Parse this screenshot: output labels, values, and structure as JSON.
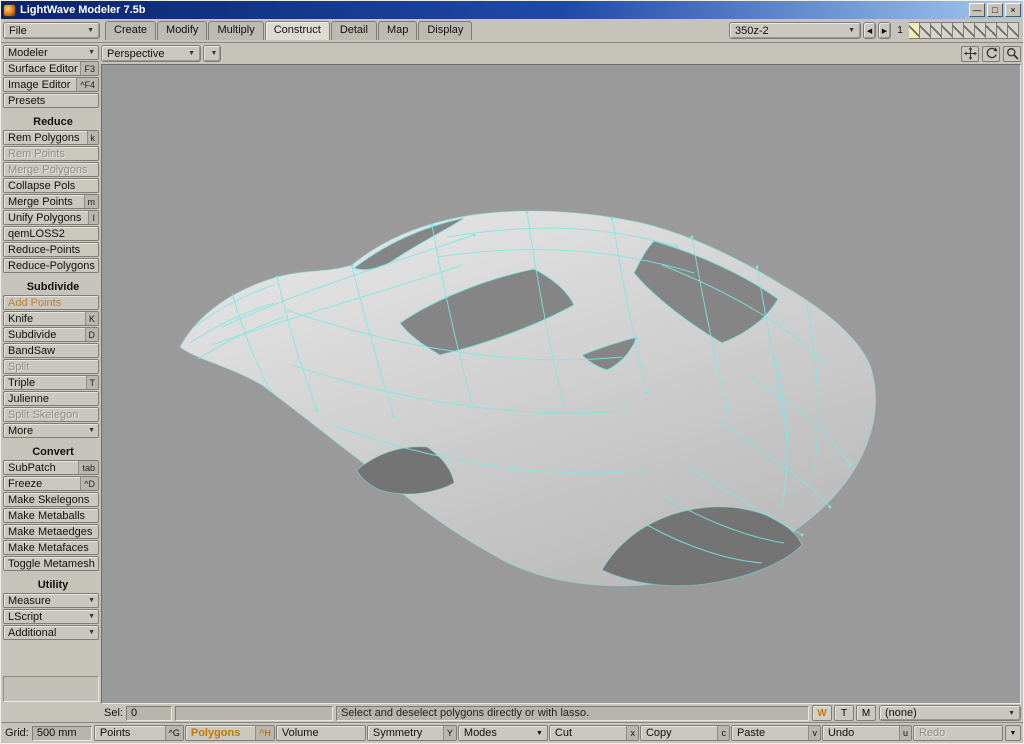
{
  "colors": {
    "viewport_bg": "#9a9a9a",
    "wireframe": "#7be8e8",
    "accent_text": "#c47a00"
  },
  "window": {
    "title": "LightWave Modeler 7.5b"
  },
  "menubar": {
    "file_label": "File",
    "tabs": [
      {
        "label": "Create"
      },
      {
        "label": "Modify"
      },
      {
        "label": "Multiply"
      },
      {
        "label": "Construct",
        "active": true
      },
      {
        "label": "Detail"
      },
      {
        "label": "Map"
      },
      {
        "label": "Display"
      }
    ],
    "object_selector_value": "350z-2",
    "layer_index": "1",
    "layers": [
      {
        "selected": true
      },
      {},
      {},
      {},
      {},
      {},
      {},
      {},
      {},
      {}
    ]
  },
  "sidebar": {
    "modeler_label": "Modeler",
    "items": [
      {
        "label": "Surface Editor",
        "shortcut": "F3"
      },
      {
        "label": "Image Editor",
        "shortcut": "^F4"
      },
      {
        "label": "Presets"
      },
      {
        "type": "header",
        "label": "Reduce"
      },
      {
        "label": "Rem Polygons",
        "shortcut": "k"
      },
      {
        "label": "Rem Points",
        "disabled": true
      },
      {
        "label": "Merge Polygons",
        "disabled": true
      },
      {
        "label": "Collapse Pols"
      },
      {
        "label": "Merge Points",
        "shortcut": "m"
      },
      {
        "label": "Unify Polygons",
        "shortcut": "I"
      },
      {
        "label": "qemLOSS2"
      },
      {
        "label": "Reduce-Points"
      },
      {
        "label": "Reduce-Polygons"
      },
      {
        "type": "header",
        "label": "Subdivide"
      },
      {
        "label": "Add Points",
        "highlight": true
      },
      {
        "label": "Knife",
        "shortcut": "K"
      },
      {
        "label": "Subdivide",
        "shortcut": "D"
      },
      {
        "label": "BandSaw"
      },
      {
        "label": "Split",
        "disabled": true
      },
      {
        "label": "Triple",
        "shortcut": "T"
      },
      {
        "label": "Julienne"
      },
      {
        "label": "Split Skelegon",
        "disabled": true
      },
      {
        "label": "More",
        "dropdown": true
      },
      {
        "type": "header",
        "label": "Convert"
      },
      {
        "label": "SubPatch",
        "shortcut": "tab"
      },
      {
        "label": "Freeze",
        "shortcut": "^D"
      },
      {
        "label": "Make Skelegons"
      },
      {
        "label": "Make Metaballs"
      },
      {
        "label": "Make Metaedges"
      },
      {
        "label": "Make Metafaces"
      },
      {
        "label": "Toggle Metamesh"
      },
      {
        "type": "header",
        "label": "Utility"
      },
      {
        "label": "Measure",
        "dropdown": true
      },
      {
        "label": "LScript",
        "dropdown": true
      },
      {
        "label": "Additional",
        "dropdown": true
      }
    ]
  },
  "viewport": {
    "view_mode": "Perspective"
  },
  "status": {
    "sel_label": "Sel:",
    "sel_count": "0",
    "info_text": "Select and deselect polygons directly or with lasso.",
    "wtm": [
      {
        "label": "W",
        "active": true
      },
      {
        "label": "T"
      },
      {
        "label": "M"
      }
    ],
    "none_selector": "(none)"
  },
  "bottombar": {
    "grid_label": "Grid:",
    "grid_value": "500 mm",
    "buttons": [
      {
        "label": "Points",
        "shortcut": "^G"
      },
      {
        "label": "Polygons",
        "shortcut": "^H",
        "active": true
      },
      {
        "label": "Volume"
      },
      {
        "label": "Symmetry",
        "shortcut": "Y"
      },
      {
        "label": "Modes",
        "dropdown": true
      },
      {
        "label": "Cut",
        "shortcut": "x"
      },
      {
        "label": "Copy",
        "shortcut": "c"
      },
      {
        "label": "Paste",
        "shortcut": "v"
      },
      {
        "label": "Undo",
        "shortcut": "u"
      },
      {
        "label": "Redo",
        "disabled": true
      }
    ]
  }
}
